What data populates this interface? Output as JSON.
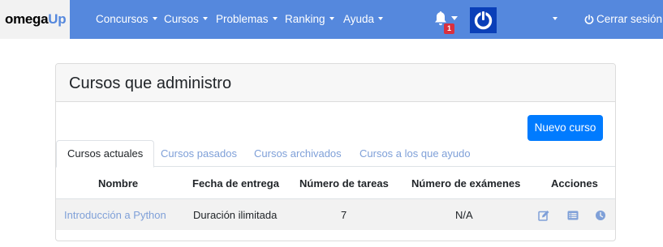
{
  "navbar": {
    "logo_prefix": "omega",
    "logo_suffix": "Up",
    "menu": [
      {
        "label": "Concursos"
      },
      {
        "label": "Cursos"
      },
      {
        "label": "Problemas"
      },
      {
        "label": "Ranking"
      },
      {
        "label": "Ayuda"
      }
    ],
    "notification_count": "1",
    "logout_label": "Cerrar sesión",
    "icons": {
      "bell": "bell-icon",
      "power": "power-icon",
      "avatar": "avatar-power-logo"
    }
  },
  "page": {
    "title": "Cursos que administro",
    "new_course_label": "Nuevo curso",
    "tabs": [
      {
        "label": "Cursos actuales",
        "active": true
      },
      {
        "label": "Cursos pasados",
        "active": false
      },
      {
        "label": "Cursos archivados",
        "active": false
      },
      {
        "label": "Cursos a los que ayudo",
        "active": false
      }
    ],
    "table": {
      "headers": [
        "Nombre",
        "Fecha de entrega",
        "Número de tareas",
        "Número de exámenes",
        "Acciones"
      ],
      "rows": [
        {
          "name": "Introducción a Python",
          "due": "Duración ilimitada",
          "tasks": "7",
          "exams": "N/A",
          "actions": [
            "edit-icon",
            "list-icon",
            "clock-icon"
          ]
        }
      ]
    }
  },
  "colors": {
    "navbar": "#5588dd",
    "primary_button": "#007bff",
    "link": "#7fa0d8",
    "badge": "#d9303e",
    "avatar": "#0a3fb8"
  }
}
